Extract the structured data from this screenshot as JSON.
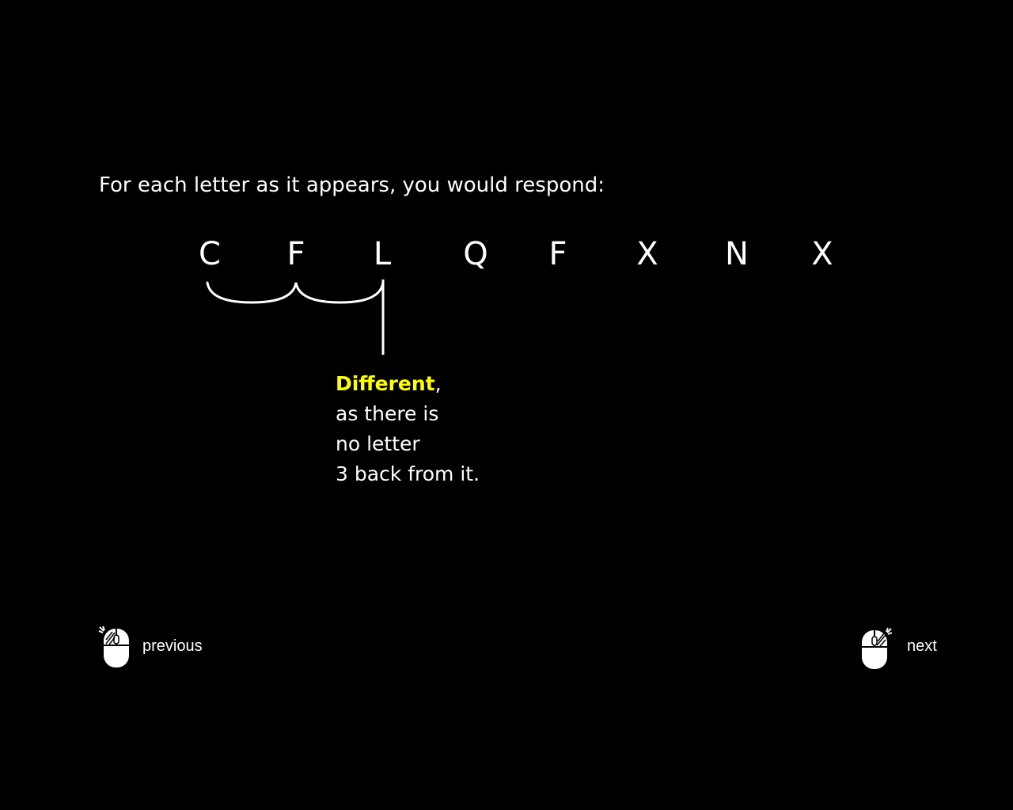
{
  "instruction": "For each letter as it appears, you would respond:",
  "letters": [
    "C",
    "F",
    "L",
    "Q",
    "F",
    "X",
    "N",
    "X"
  ],
  "explanation": {
    "highlight": "Different",
    "highlight_suffix": ",",
    "lines": [
      "as there is",
      "no letter",
      "3 back from it."
    ]
  },
  "navigation": {
    "previous_label": "previous",
    "next_label": "next",
    "previous_icon": "mouse-left-click-icon",
    "next_icon": "mouse-right-click-icon"
  },
  "colors": {
    "background": "#000000",
    "text": "#ffffff",
    "highlight": "#ffff00"
  }
}
